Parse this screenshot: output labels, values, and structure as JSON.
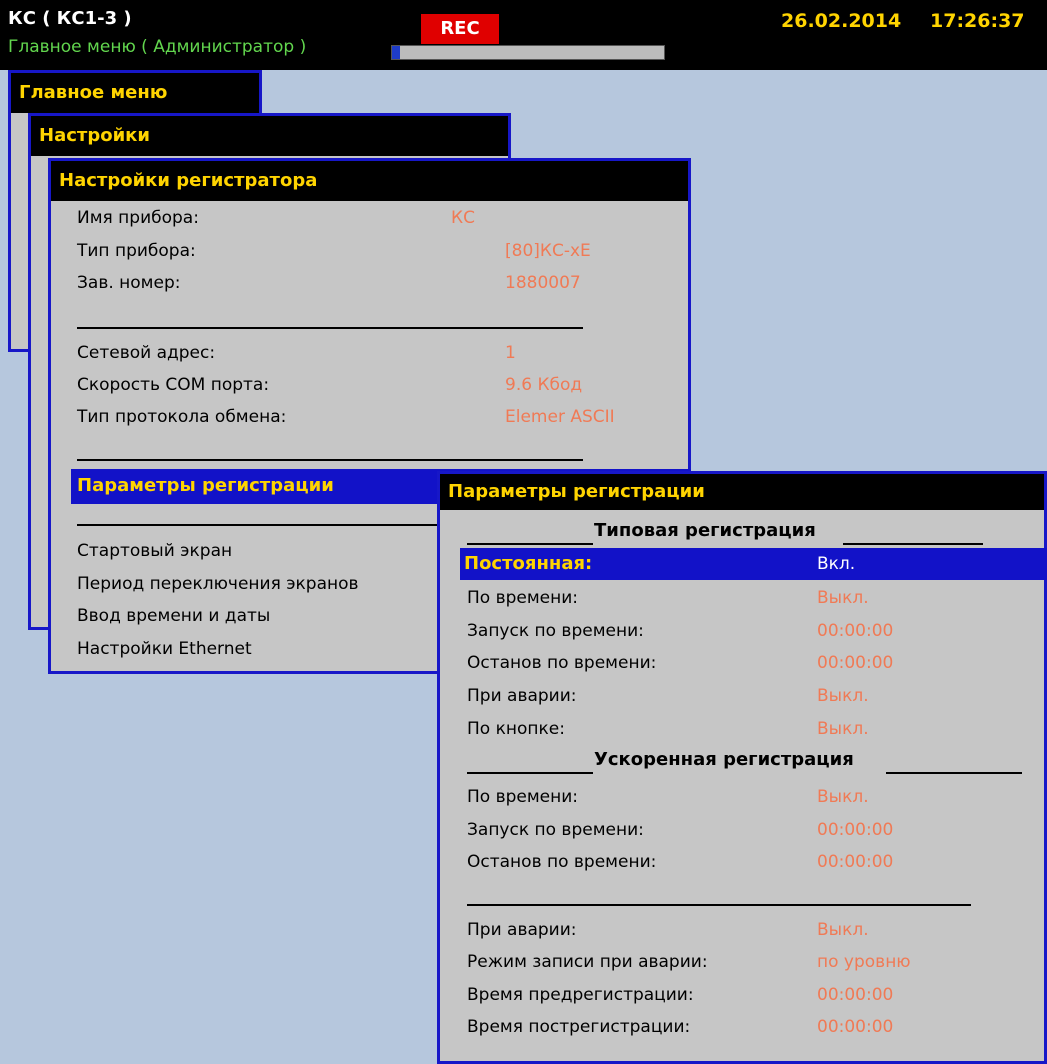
{
  "header": {
    "device_title": "КС ( КС1-3 )",
    "subtitle": "Главное меню ( Администратор )",
    "rec_label": "REC",
    "date": "26.02.2014",
    "time": "17:26:37",
    "progress_fraction": 0.03,
    "colors": {
      "rec_bg": "#e00000",
      "accent_yellow": "#ffd400",
      "subtitle_green": "#62d64e",
      "progress_fill": "#1e3cc8"
    }
  },
  "main_menu": {
    "title": "Главное меню"
  },
  "settings": {
    "title": "Настройки"
  },
  "recorder_settings": {
    "title": "Настройки регистратора",
    "device_name": {
      "label": "Имя прибора:",
      "value": "КС"
    },
    "device_type": {
      "label": "Тип прибора:",
      "value": "[80]КС-xE"
    },
    "serial_no": {
      "label": "Зав. номер:",
      "value": "1880007"
    },
    "net_address": {
      "label": "Сетевой адрес:",
      "value": "1"
    },
    "com_speed": {
      "label": "Скорость COM порта:",
      "value": "9.6 Кбод"
    },
    "protocol": {
      "label": "Тип протокола обмена:",
      "value": "Elemer ASCII"
    },
    "selected_item": "Параметры регистрации",
    "menu_items": [
      "Стартовый экран",
      "Период переключения экранов",
      "Ввод времени и даты",
      "Настройки Ethernet"
    ]
  },
  "registration_params": {
    "title": "Параметры регистрации",
    "typical_section": "Типовая регистрация",
    "constant": {
      "label": "Постоянная:",
      "value": "Вкл."
    },
    "typical_rows": [
      {
        "label": "По времени:",
        "value": "Выкл."
      },
      {
        "label": "Запуск по времени:",
        "value": "00:00:00"
      },
      {
        "label": "Останов по времени:",
        "value": "00:00:00"
      },
      {
        "label": "При аварии:",
        "value": "Выкл."
      },
      {
        "label": "По кнопке:",
        "value": "Выкл."
      }
    ],
    "accelerated_section": "Ускоренная регистрация",
    "accelerated_rows": [
      {
        "label": "По времени:",
        "value": "Выкл."
      },
      {
        "label": "Запуск по времени:",
        "value": "00:00:00"
      },
      {
        "label": "Останов по времени:",
        "value": "00:00:00"
      }
    ],
    "alarm_rows": [
      {
        "label": "При аварии:",
        "value": "Выкл."
      },
      {
        "label": "Режим записи при аварии:",
        "value": "по уровню"
      },
      {
        "label": "Время предрегистрации:",
        "value": "00:00:00"
      },
      {
        "label": "Время пострегистрации:",
        "value": "00:00:00"
      }
    ]
  }
}
